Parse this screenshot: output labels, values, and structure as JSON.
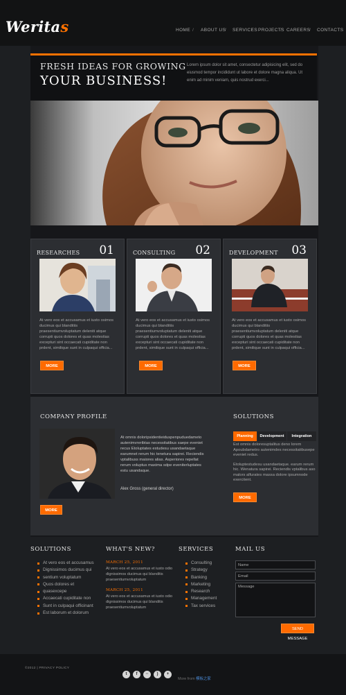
{
  "logo": {
    "text": "Werita",
    "accent": "s"
  },
  "nav": [
    {
      "label": "HOME"
    },
    {
      "label": "ABOUT US"
    },
    {
      "label": "SERVICES"
    },
    {
      "label": "PROJECTS"
    },
    {
      "label": "CAREERS"
    },
    {
      "label": "CONTACTS"
    }
  ],
  "hero": {
    "title_line1": "FRESH IDEAS FOR GROWING",
    "title_line2": "YOUR BUSINESS!",
    "text": "Lorem ipsum dolor sit amet, consectetur adipisicing elit, sed do eiusmod tempor incididunt ut labore et dolore magna aliqua. Ut enim ad minim veniam, quis nostrud exerci..."
  },
  "columns": [
    {
      "title": "RESEARCHES",
      "number": "01",
      "text": "At vero eos et accusamus et iusto osimos ducimus qui blanditiis praesentiumvoluptatum deleniti atque corrupti quos dolores et quas molestias excepturi sint occaecati cupiditate non prdent, similique sunt in culpaqui officia...",
      "button": "MORE"
    },
    {
      "title": "CONSULTING",
      "number": "02",
      "text": "At vero eos et accusamus et iusto osimos ducimus qui blanditiis praesentiumvoluptatum deleniti atque corrupti quos dolores et quas molestias excepturi sint occaecati cupiditate non prdent, similique sunt in culpaqui officia...",
      "button": "MORE"
    },
    {
      "title": "DEVELOPMENT",
      "number": "03",
      "text": "At vero eos et accusamus et iusto osimos ducimus qui blanditiis praesentiumvoluptatum deleniti atque corrupti quos dolores et quas molestias excepturi sint occaecati cupiditate non prdent, similique sunt in culpaqui officia...",
      "button": "MORE"
    }
  ],
  "profile": {
    "title": "COMPANY PROFILE",
    "text": "At omnis doloripsidentieiduspenpuduedameto autenimvreribtas necessitatibus saepe eveniet recus Etoluptates estudesu usandaetaque earumnet rerum hic tenetura sapirei. Reciendis vptalibuss maiores alias. Asperiores repellat rerum voluptus maxima sdpe eveniterluptates estu usandaque.",
    "signature": "Alex Gross (general director)",
    "button": "MORE"
  },
  "solutions_tabs": {
    "title": "SOLUTIONS",
    "tabs": [
      {
        "label": "Planning"
      },
      {
        "label": "Development"
      },
      {
        "label": "Integration"
      }
    ],
    "para1": "Est omnis doloresuptalitus deno lorem Apoubdametro autenimdes necessitatibusepe eveniet redus.",
    "para2": "Etoluptestudesu usandaetaque. earum rerum hic. Wenatura sapirei. Reciendis vptalibus aso malors alfurates massa dolore ipsumnode exercitent.",
    "button": "MORE"
  },
  "footer": {
    "solutions": {
      "title": "SOLUTIONS",
      "items": [
        "At vero eos et accusamus",
        "Dignissimos ducimus qui",
        "sentium voluptatum",
        "Quos dolores et",
        "quasexcepe",
        "Accaecati cupiditate non",
        "Sunt in culpaqui officinant",
        "Est laborum et dolorum"
      ]
    },
    "news": {
      "title": "WHAT'S NEW?",
      "items": [
        {
          "date": "MARCH 25, 2011",
          "text": "At vero eos et accusamus et iusto odio dignissimos ducimus qui blanditis praesentiumvoluptatum"
        },
        {
          "date": "MARCH 25, 2011",
          "text": "At vero eos et accusamus et iusto odio dignissimos ducimus qui blanditis praesentiumvoluptatum"
        }
      ]
    },
    "services": {
      "title": "SERVICES",
      "items": [
        "Consulting",
        "Strategy",
        "Banking",
        "Marketing",
        "Research",
        "Management",
        "Tax services"
      ]
    },
    "mail": {
      "title": "MAIL US",
      "name_placeholder": "Name",
      "email_placeholder": "Email",
      "message_placeholder": "Message",
      "button": "SEND MESSAGE"
    }
  },
  "bottom": {
    "copyright": "©2012 | PRIVACY POLICY",
    "social_icons": [
      "twitter-icon",
      "facebook-icon",
      "flickr-icon",
      "rss-icon",
      "plus-icon"
    ],
    "credit_prefix": "More from",
    "credit_link": "模板之家"
  },
  "colors": {
    "accent": "#ff6a00",
    "background": "#1d1f22",
    "panel": "#2c2e32"
  }
}
